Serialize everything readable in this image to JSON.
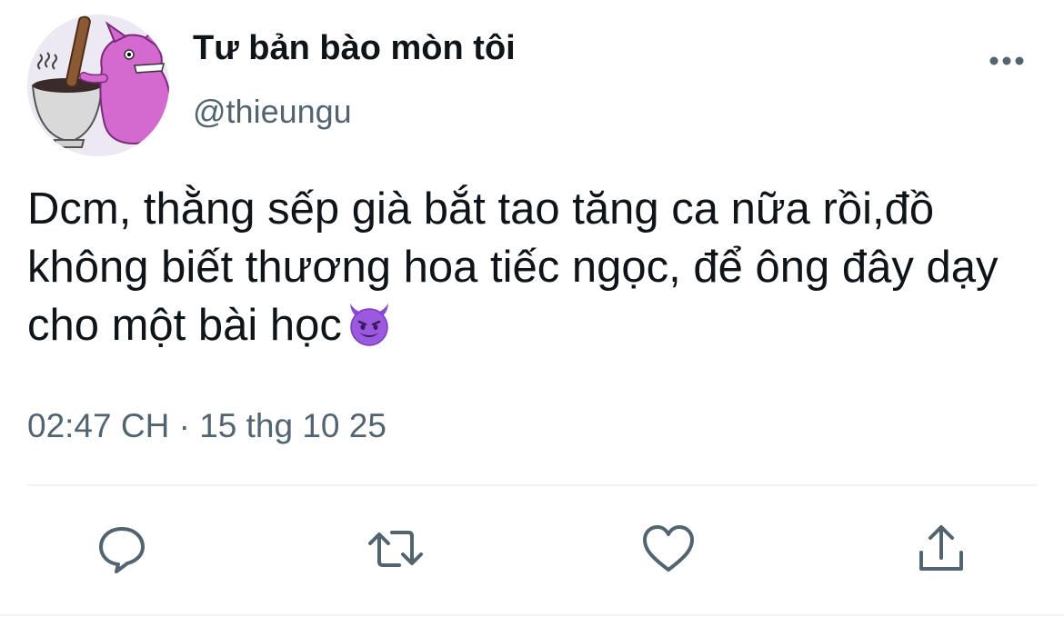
{
  "tweet": {
    "display_name": "Tư bản bào mòn tôi",
    "handle": "@thieungu",
    "text": "Dcm, thằng sếp già bắt tao tăng ca nữa rồi,đồ không biết thương hoa tiếc ngọc, để ông đây dạy cho một bài học",
    "emoji": "smiling-face-with-horns",
    "timestamp": "02:47 CH · 15 thg 10 25"
  },
  "actions": [
    {
      "name": "reply",
      "icon": "speech-bubble-icon"
    },
    {
      "name": "retweet",
      "icon": "retweet-arrows-icon"
    },
    {
      "name": "like",
      "icon": "heart-icon"
    },
    {
      "name": "share",
      "icon": "share-upload-icon"
    }
  ],
  "colors": {
    "text_primary": "#0f1419",
    "text_secondary": "#536471",
    "icon": "#536471",
    "divider": "#eff3f4",
    "emoji": "#8a4bd0"
  }
}
